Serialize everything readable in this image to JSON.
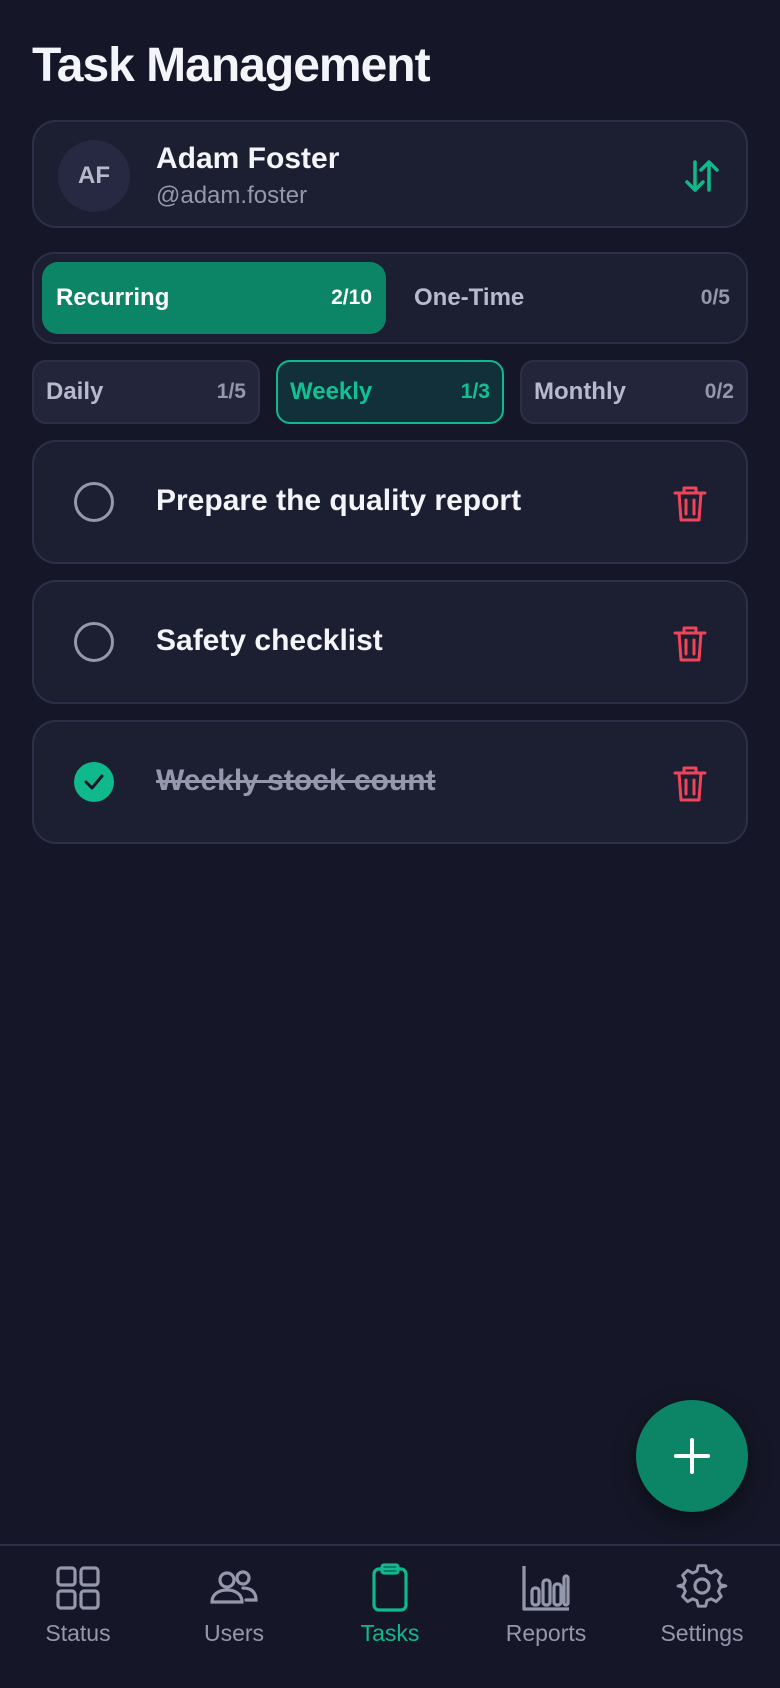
{
  "header": {
    "title": "Task Management"
  },
  "user": {
    "initials": "AF",
    "name": "Adam Foster",
    "handle": "@adam.foster"
  },
  "type_tabs": [
    {
      "label": "Recurring",
      "count": "2/10",
      "active": true
    },
    {
      "label": "One-Time",
      "count": "0/5",
      "active": false
    }
  ],
  "frequency_tabs": [
    {
      "label": "Daily",
      "count": "1/5",
      "active": false
    },
    {
      "label": "Weekly",
      "count": "1/3",
      "active": true
    },
    {
      "label": "Monthly",
      "count": "0/2",
      "active": false
    }
  ],
  "tasks": [
    {
      "title": "Prepare the quality report",
      "completed": false
    },
    {
      "title": "Safety checklist",
      "completed": false
    },
    {
      "title": "Weekly stock count",
      "completed": true
    }
  ],
  "bottom_nav": [
    {
      "label": "Status",
      "icon": "grid-icon",
      "active": false
    },
    {
      "label": "Users",
      "icon": "users-icon",
      "active": false
    },
    {
      "label": "Tasks",
      "icon": "clipboard-icon",
      "active": true
    },
    {
      "label": "Reports",
      "icon": "bar-chart-icon",
      "active": false
    },
    {
      "label": "Settings",
      "icon": "gear-icon",
      "active": false
    }
  ],
  "colors": {
    "background": "#151728",
    "card": "#1c1e31",
    "accent": "#10b98c",
    "accent_dark": "#0b8566",
    "danger": "#f0445a",
    "muted": "#9598ac"
  }
}
